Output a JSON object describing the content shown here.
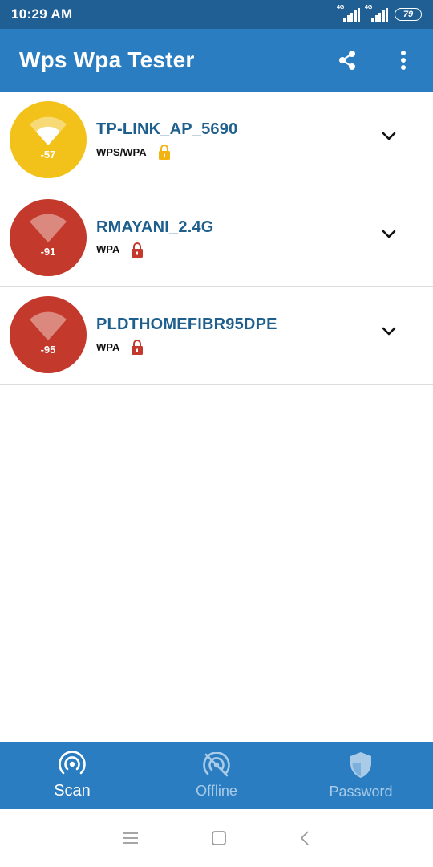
{
  "status_bar": {
    "time": "10:29 AM",
    "net1": "4G",
    "net2": "4G",
    "battery": "79"
  },
  "app_bar": {
    "title": "Wps Wpa Tester"
  },
  "networks": [
    {
      "ssid": "TP-LINK_AP_5690",
      "security": "WPS/WPA",
      "rssi": "-57",
      "color": "#f2c21b",
      "lock_color": "#f2b311"
    },
    {
      "ssid": "RMAYANI_2.4G",
      "security": "WPA",
      "rssi": "-91",
      "color": "#c3392b",
      "lock_color": "#c3392b"
    },
    {
      "ssid": "PLDTHOMEFIBR95DPE",
      "security": "WPA",
      "rssi": "-95",
      "color": "#c3392b",
      "lock_color": "#c3392b"
    }
  ],
  "bottom_nav": {
    "items": [
      {
        "label": "Scan",
        "icon": "scan-icon",
        "active": true
      },
      {
        "label": "Offline",
        "icon": "offline-icon",
        "active": false
      },
      {
        "label": "Password",
        "icon": "shield-icon",
        "active": false
      }
    ]
  },
  "colors": {
    "primary": "#2a7dc0",
    "status_bar": "#1f5f94",
    "ssid_text": "#1e5f8e"
  }
}
